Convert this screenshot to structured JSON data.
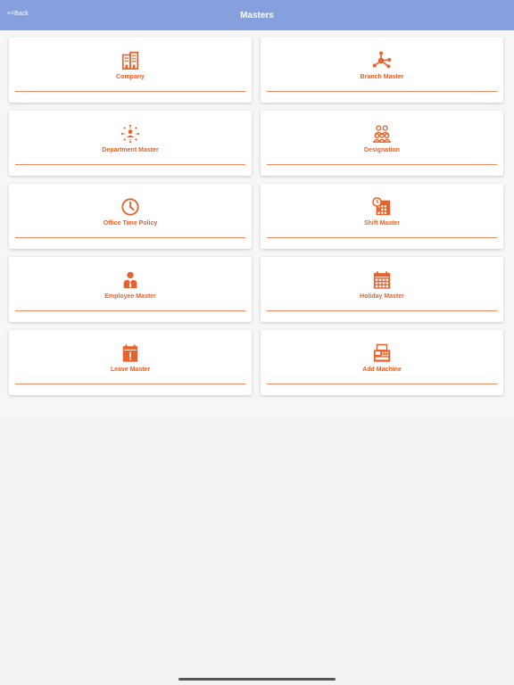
{
  "navbar": {
    "back_label": "<<Back",
    "title": "Masters",
    "background": "#86a0de"
  },
  "accent_color": "#e8622b",
  "cards": [
    {
      "label": "Company",
      "icon": "building-icon"
    },
    {
      "label": "Branch Master",
      "icon": "branch-network-icon"
    },
    {
      "label": "Department Master",
      "icon": "department-people-icon"
    },
    {
      "label": "Designation",
      "icon": "group-users-icon"
    },
    {
      "label": "Office Time Policy",
      "icon": "clock-icon"
    },
    {
      "label": "Shift Master",
      "icon": "calendar-clock-icon"
    },
    {
      "label": "Employee Master",
      "icon": "employee-icon"
    },
    {
      "label": "Holiday Master",
      "icon": "calendar-grid-icon"
    },
    {
      "label": "Leave Master",
      "icon": "calendar-alert-icon"
    },
    {
      "label": "Add Machine",
      "icon": "fax-machine-icon"
    }
  ]
}
